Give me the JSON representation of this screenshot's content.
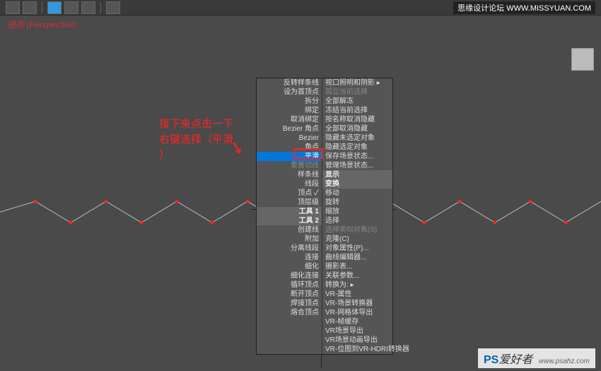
{
  "viewport_label": "透视 (Perspective)",
  "annotation": {
    "line1": "接下来点击一下",
    "line2": "右键选择（平滑",
    "line3": "）"
  },
  "toolbar": {
    "items": [
      "",
      "",
      "",
      "",
      "",
      ""
    ]
  },
  "menu": {
    "left": [
      {
        "label": "反转样条线",
        "type": "item"
      },
      {
        "label": "设为首顶点",
        "type": "item"
      },
      {
        "label": "拆分",
        "type": "item"
      },
      {
        "label": "绑定",
        "type": "item"
      },
      {
        "label": "取消绑定",
        "type": "item"
      },
      {
        "label": "Bezier 角点",
        "type": "item"
      },
      {
        "label": "Bezier",
        "type": "item"
      },
      {
        "label": "角点",
        "type": "item"
      },
      {
        "label": "平滑",
        "type": "highlight"
      },
      {
        "label": "重置切线",
        "type": "dimmed"
      },
      {
        "label": "样条线",
        "type": "item"
      },
      {
        "label": "线段",
        "type": "item"
      },
      {
        "label": "顶点 ✓",
        "type": "item"
      },
      {
        "label": "顶层级",
        "type": "item"
      },
      {
        "label": "工具 1",
        "type": "header"
      },
      {
        "label": "工具 2",
        "type": "header"
      },
      {
        "label": "创建线",
        "type": "item"
      },
      {
        "label": "附加",
        "type": "item"
      },
      {
        "label": "分离线段",
        "type": "item"
      },
      {
        "label": "连接",
        "type": "item"
      },
      {
        "label": "细化",
        "type": "item"
      },
      {
        "label": "细化连接",
        "type": "item"
      },
      {
        "label": "循环顶点",
        "type": "item"
      },
      {
        "label": "断开顶点",
        "type": "item"
      },
      {
        "label": "焊接顶点",
        "type": "item"
      },
      {
        "label": "熔合顶点",
        "type": "item"
      }
    ],
    "right": [
      {
        "label": "视口照明和阴影 ▸",
        "type": "item"
      },
      {
        "label": "孤立当前选择",
        "type": "dimmed"
      },
      {
        "label": "全部解冻",
        "type": "item"
      },
      {
        "label": "冻结当前选择",
        "type": "item"
      },
      {
        "label": "按名称取消隐藏",
        "type": "item"
      },
      {
        "label": "全部取消隐藏",
        "type": "item"
      },
      {
        "label": "隐藏未选定对象",
        "type": "item"
      },
      {
        "label": "隐藏选定对象",
        "type": "item"
      },
      {
        "label": "保存场景状态...",
        "type": "item"
      },
      {
        "label": "管理场景状态...",
        "type": "item"
      },
      {
        "label": "显示",
        "type": "header"
      },
      {
        "label": "变换",
        "type": "header"
      },
      {
        "label": "移动",
        "type": "item"
      },
      {
        "label": "旋转",
        "type": "item"
      },
      {
        "label": "缩放",
        "type": "item"
      },
      {
        "label": "选择",
        "type": "item"
      },
      {
        "label": "选择类似对象(S)",
        "type": "dimmed"
      },
      {
        "label": "克隆(C)",
        "type": "item"
      },
      {
        "label": "对象属性(P)...",
        "type": "item"
      },
      {
        "label": "曲线编辑器...",
        "type": "item"
      },
      {
        "label": "摄影表...",
        "type": "item"
      },
      {
        "label": "关联参数...",
        "type": "item"
      },
      {
        "label": "转换为: ▸",
        "type": "item"
      },
      {
        "label": "VR-属性",
        "type": "item"
      },
      {
        "label": "VR-场景转换器",
        "type": "item"
      },
      {
        "label": "VR-网格体导出",
        "type": "item"
      },
      {
        "label": "VR-帧缓存",
        "type": "item"
      },
      {
        "label": "VR场景导出",
        "type": "item"
      },
      {
        "label": "VR场景动画导出",
        "type": "item"
      },
      {
        "label": "VR-位图到VR-HDRI转换器",
        "type": "item"
      }
    ]
  },
  "watermarks": {
    "top": "思缘设计论坛 WWW.MISSYUAN.COM",
    "bottom_brand": "PS",
    "bottom_text": "爱好者",
    "bottom_url": "www.psahz.com"
  }
}
